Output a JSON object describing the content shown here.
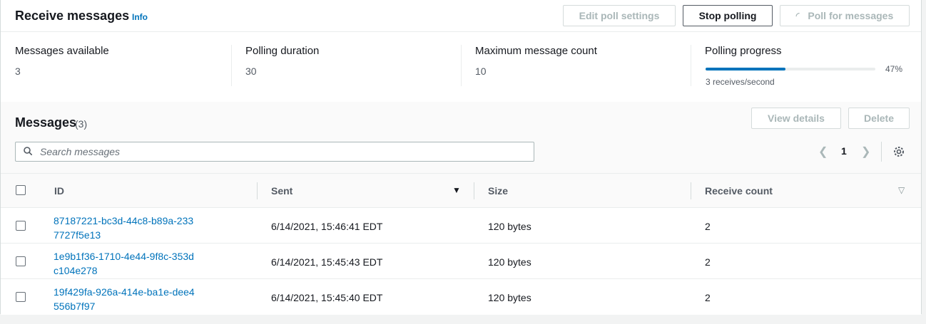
{
  "header": {
    "title": "Receive messages",
    "info_label": "Info",
    "buttons": {
      "edit_poll_settings": "Edit poll settings",
      "stop_polling": "Stop polling",
      "poll_for_messages": "Poll for messages"
    }
  },
  "stats": {
    "messages_available": {
      "label": "Messages available",
      "value": "3"
    },
    "polling_duration": {
      "label": "Polling duration",
      "value": "30"
    },
    "max_message_count": {
      "label": "Maximum message count",
      "value": "10"
    },
    "polling_progress": {
      "label": "Polling progress",
      "percent_text": "47%",
      "percent": 47,
      "rate": "3 receives/second"
    }
  },
  "messages": {
    "title": "Messages",
    "count": "(3)",
    "buttons": {
      "view_details": "View details",
      "delete": "Delete"
    },
    "search_placeholder": "Search messages",
    "page": "1",
    "columns": {
      "id": "ID",
      "sent": "Sent",
      "size": "Size",
      "receive_count": "Receive count"
    },
    "rows": [
      {
        "id": "87187221-bc3d-44c8-b89a-2337727f5e13",
        "sent": "6/14/2021, 15:46:41 EDT",
        "size": "120 bytes",
        "receive_count": "2"
      },
      {
        "id": "1e9b1f36-1710-4e44-9f8c-353dc104e278",
        "sent": "6/14/2021, 15:45:43 EDT",
        "size": "120 bytes",
        "receive_count": "2"
      },
      {
        "id": "19f429fa-926a-414e-ba1e-dee4556b7f97",
        "sent": "6/14/2021, 15:45:40 EDT",
        "size": "120 bytes",
        "receive_count": "2"
      }
    ]
  },
  "colors": {
    "accent": "#0073bb",
    "text": "#16191f",
    "muted": "#545b64",
    "disabled": "#aab7b8"
  }
}
